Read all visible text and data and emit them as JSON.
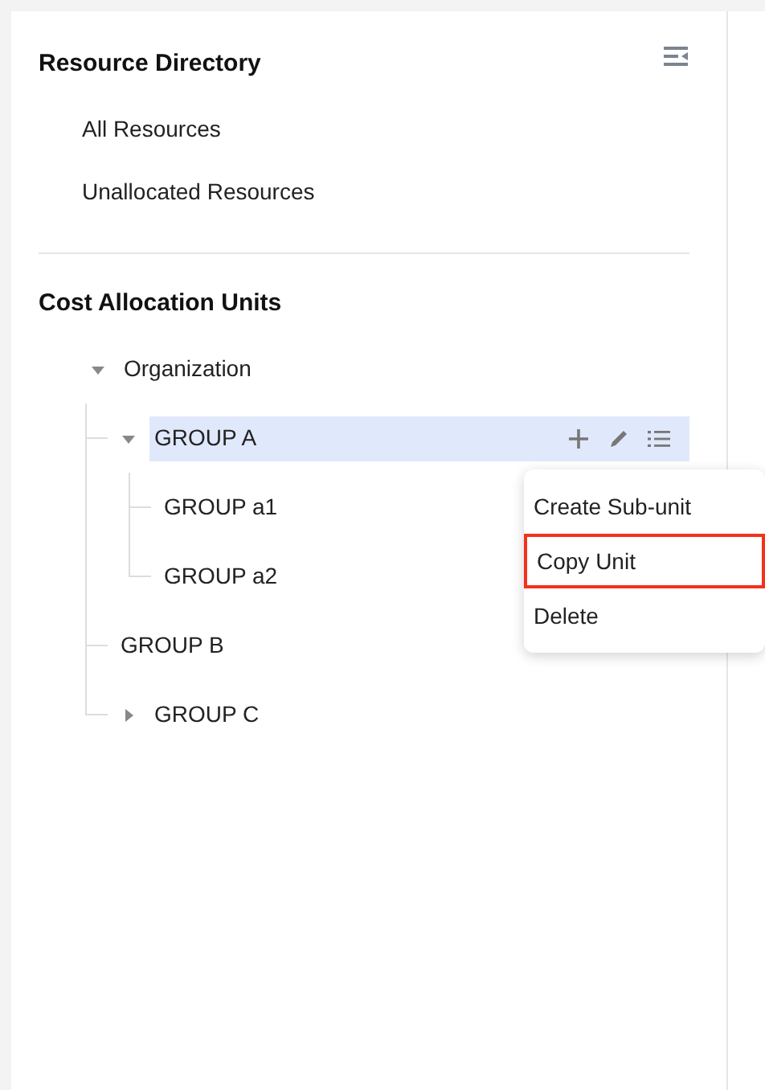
{
  "directory": {
    "title": "Resource Directory",
    "items": [
      {
        "label": "All Resources"
      },
      {
        "label": "Unallocated Resources"
      }
    ]
  },
  "units": {
    "title": "Cost Allocation Units",
    "tree": [
      {
        "label": "Organization",
        "expanded": true,
        "selected": false,
        "children": [
          {
            "label": "GROUP A",
            "expanded": true,
            "selected": true,
            "children": [
              {
                "label": "GROUP a1",
                "selected": false
              },
              {
                "label": "GROUP a2",
                "selected": false
              }
            ]
          },
          {
            "label": "GROUP B",
            "selected": false
          },
          {
            "label": "GROUP C",
            "expanded": false,
            "selected": false,
            "has_children": true
          }
        ]
      }
    ]
  },
  "context_menu": [
    {
      "label": "Create Sub-unit",
      "selected": false
    },
    {
      "label": "Copy Unit",
      "selected": true
    },
    {
      "label": "Delete",
      "selected": false
    }
  ]
}
